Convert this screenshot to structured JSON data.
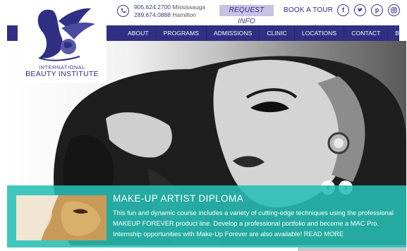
{
  "header": {
    "phones": [
      {
        "number": "905.624.2700",
        "city": "Mississauga"
      },
      {
        "number": "289.674.0888",
        "city": "Hamilton"
      }
    ],
    "request_label": "REQUEST INFO",
    "tour_label": "BOOK A TOUR",
    "social": [
      {
        "icon": "facebook-icon",
        "glyph": "f"
      },
      {
        "icon": "twitter-icon",
        "glyph": "t"
      },
      {
        "icon": "pinterest-icon",
        "glyph": "p"
      },
      {
        "icon": "instagram-icon",
        "glyph": "◎"
      }
    ]
  },
  "logo": {
    "line1": "INTERNATIONAL",
    "line2": "BEAUTY INSTITUTE"
  },
  "nav": {
    "items": [
      "ABOUT US",
      "PROGRAMS",
      "ADMISSIONS",
      "CLINIC",
      "LOCATIONS",
      "CONTACT",
      "BLOG"
    ]
  },
  "slide": {
    "title": "MAKE-UP ARTIST DIPLOMA",
    "body": "This fun and dynamic course includes a variety of cutting-edge techniques using the professional MAKEUP FOREVER product line. Develop a professional portfolio and become a MAC Pro.   Internship opportunities with Make-Up Forever are also available!",
    "read_more": "READ MORE",
    "prev_glyph": "‹",
    "next_glyph": "›"
  },
  "colors": {
    "brand": "#2f2f83",
    "request_bg": "#c9c0e6",
    "teal_overlay": "#26beb4"
  }
}
